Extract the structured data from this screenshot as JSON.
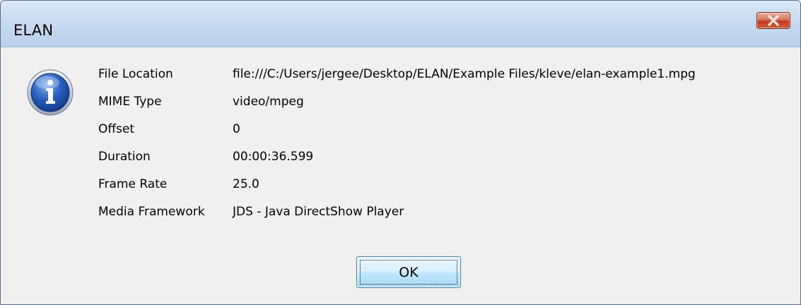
{
  "window": {
    "title": "ELAN"
  },
  "dialog": {
    "icon": "info-icon",
    "fields": [
      {
        "label": "File Location",
        "value": "file:///C:/Users/jergee/Desktop/ELAN/Example Files/kleve/elan-example1.mpg"
      },
      {
        "label": "MIME Type",
        "value": "video/mpeg"
      },
      {
        "label": "Offset",
        "value": "0"
      },
      {
        "label": "Duration",
        "value": "00:00:36.599"
      },
      {
        "label": "Frame Rate",
        "value": "25.0"
      },
      {
        "label": "Media Framework",
        "value": "JDS - Java DirectShow Player"
      }
    ],
    "ok_label": "OK"
  },
  "colors": {
    "titlebar": "#c8dbef",
    "close_button": "#c33b1f",
    "info_icon": "#1f4fa8"
  }
}
